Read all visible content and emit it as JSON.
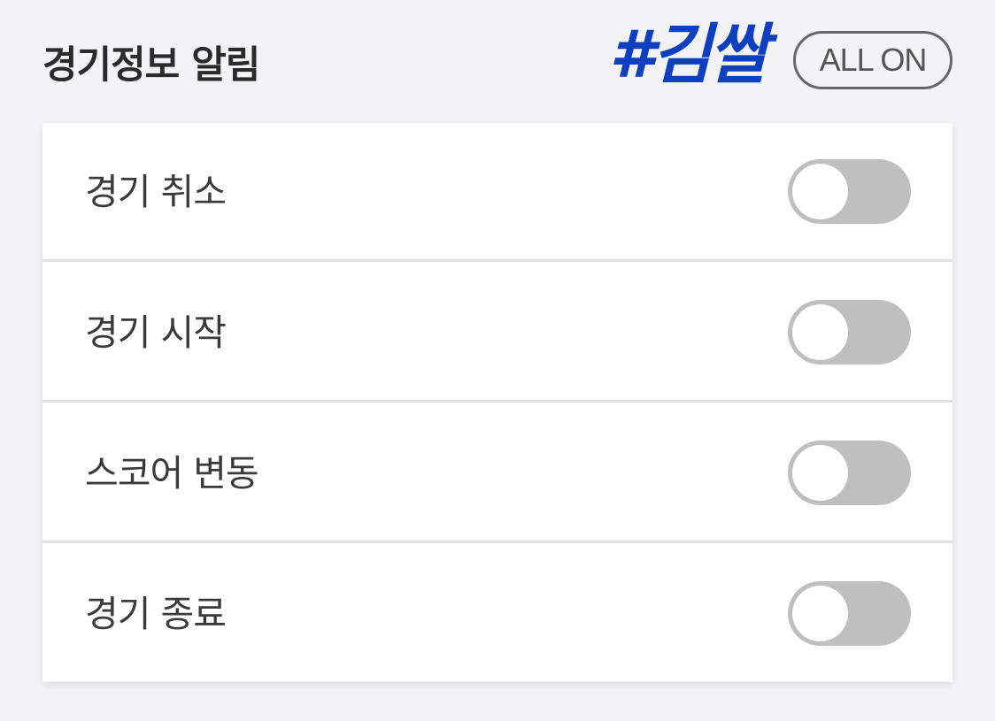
{
  "header": {
    "title": "경기정보 알림",
    "brand_tag": "#김쌀",
    "all_on_label": "ALL ON"
  },
  "settings": [
    {
      "label": "경기 취소",
      "enabled": false
    },
    {
      "label": "경기 시작",
      "enabled": false
    },
    {
      "label": "스코어 변동",
      "enabled": false
    },
    {
      "label": "경기 종료",
      "enabled": false
    }
  ],
  "colors": {
    "background": "#f3f3f5",
    "brand": "#0d3fbf",
    "toggle_off": "#bfbfbf",
    "card": "#ffffff"
  }
}
